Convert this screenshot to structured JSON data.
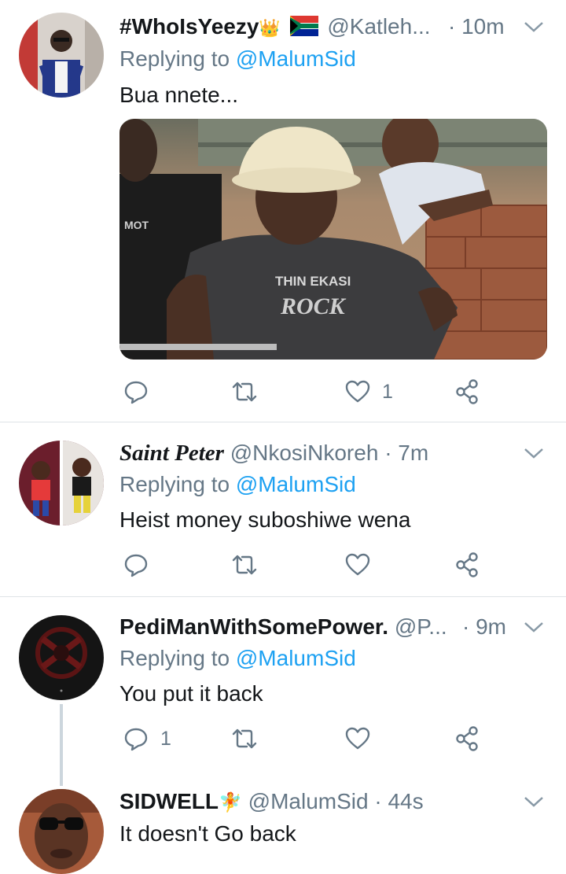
{
  "tweets": [
    {
      "name": "#WhoIsYeezy",
      "name_emoji": "👑",
      "handle": "@Katleh...",
      "time": "· 10m",
      "replying_prefix": "Replying to ",
      "replying_to": "@MalumSid",
      "text": "Bua nnete...",
      "has_media": true,
      "media_shirt_text_1": "THIN EKASI",
      "media_shirt_text_2": "ROCK",
      "media_shirt_text_3": "MOT",
      "counts": {
        "reply": "",
        "retweet": "",
        "like": "1"
      }
    },
    {
      "name": "Saint Peter",
      "handle": "@NkosiNkoreh",
      "time": "· 7m",
      "replying_prefix": "Replying to ",
      "replying_to": "@MalumSid",
      "text": "Heist money suboshiwe wena",
      "counts": {
        "reply": "",
        "retweet": "",
        "like": ""
      }
    },
    {
      "name": "PediManWithSomePower.",
      "handle": "@P...",
      "time": "· 9m",
      "replying_prefix": "Replying to ",
      "replying_to": "@MalumSid",
      "text": "You put it back",
      "counts": {
        "reply": "1",
        "retweet": "",
        "like": ""
      }
    },
    {
      "name": "SIDWELL",
      "name_emoji": "🧚",
      "handle": "@MalumSid",
      "time": "· 44s",
      "text": "It doesn't Go back"
    }
  ],
  "colors": {
    "accent": "#1da1f2",
    "secondary_text": "#657786",
    "divider": "#dfe3e6",
    "thread_line": "#ccd6dd"
  },
  "icons": [
    "chevron-down-icon",
    "reply-icon",
    "retweet-icon",
    "like-icon",
    "share-icon",
    "crown-emoji",
    "south-africa-flag-icon",
    "fairy-emoji"
  ]
}
